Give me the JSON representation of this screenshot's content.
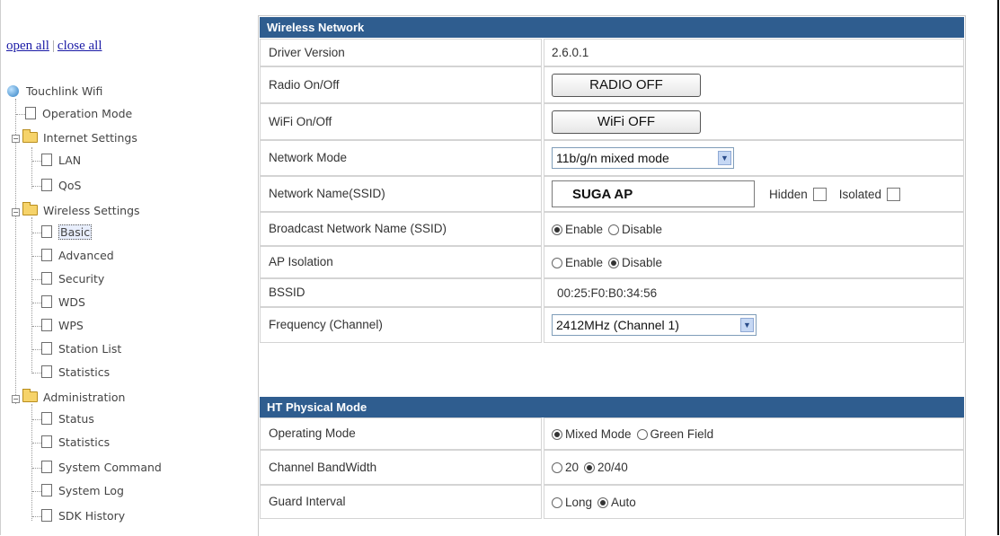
{
  "tree_toggle": {
    "open_all": "open all",
    "close_all": "close all"
  },
  "tree": {
    "root": "Touchlink Wifi",
    "operation_mode": "Operation Mode",
    "internet_settings": "Internet Settings",
    "lan": "LAN",
    "qos": "QoS",
    "wireless_settings": "Wireless Settings",
    "basic": "Basic",
    "advanced": "Advanced",
    "security": "Security",
    "wds": "WDS",
    "wps": "WPS",
    "station_list": "Station List",
    "statistics": "Statistics",
    "administration": "Administration",
    "status": "Status",
    "admin_statistics": "Statistics",
    "system_command": "System Command",
    "system_log": "System Log",
    "sdk_history": "SDK History"
  },
  "wireless": {
    "header": "Wireless Network",
    "driver_version": {
      "label": "Driver Version",
      "value": "2.6.0.1"
    },
    "radio": {
      "label": "Radio On/Off",
      "button": "RADIO OFF"
    },
    "wifi": {
      "label": "WiFi On/Off",
      "button": "WiFi OFF"
    },
    "network_mode": {
      "label": "Network Mode",
      "value": "11b/g/n mixed mode"
    },
    "ssid": {
      "label": "Network Name(SSID)",
      "value": "SUGA AP",
      "hidden": "Hidden",
      "isolated": "Isolated"
    },
    "broadcast": {
      "label": "Broadcast Network Name (SSID)",
      "enable": "Enable",
      "disable": "Disable",
      "selected": "enable"
    },
    "ap_isolation": {
      "label": "AP Isolation",
      "enable": "Enable",
      "disable": "Disable",
      "selected": "disable"
    },
    "bssid": {
      "label": "BSSID",
      "value": "00:25:F0:B0:34:56"
    },
    "frequency": {
      "label": "Frequency (Channel)",
      "value": "2412MHz (Channel 1)"
    }
  },
  "ht": {
    "header": "HT Physical Mode",
    "operating_mode": {
      "label": "Operating Mode",
      "mixed": "Mixed Mode",
      "green": "Green Field",
      "selected": "mixed"
    },
    "bandwidth": {
      "label": "Channel BandWidth",
      "opt20": "20",
      "opt2040": "20/40",
      "selected": "20/40"
    },
    "guard_interval": {
      "label": "Guard Interval",
      "long": "Long",
      "auto": "Auto",
      "selected": "auto"
    }
  },
  "colors": {
    "section_header": "#2f5d8f",
    "link": "#1a1aa6"
  }
}
